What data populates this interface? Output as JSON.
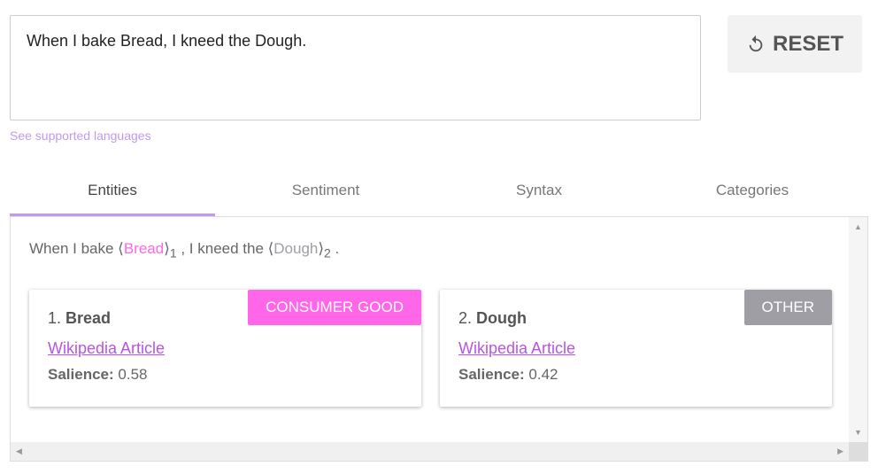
{
  "input": {
    "value": "When I bake Bread, I kneed the Dough."
  },
  "languages_link": "See supported languages",
  "reset": {
    "label": "RESET",
    "icon": "reset-icon"
  },
  "tabs": [
    {
      "label": "Entities",
      "active": true
    },
    {
      "label": "Sentiment"
    },
    {
      "label": "Syntax"
    },
    {
      "label": "Categories"
    }
  ],
  "sentence": {
    "p1": "When I bake ",
    "e1": "Bread",
    "n1": "1",
    "p2": " , I kneed the ",
    "e2": "Dough",
    "n2": "2",
    "p3": " ."
  },
  "entities": [
    {
      "index": "1.",
      "name": "Bread",
      "type": "CONSUMER GOOD",
      "color": "#ff66e8",
      "link": "Wikipedia Article",
      "salience_label": "Salience:",
      "salience": "0.58"
    },
    {
      "index": "2.",
      "name": "Dough",
      "type": "OTHER",
      "color": "#9e9ea4",
      "link": "Wikipedia Article",
      "salience_label": "Salience:",
      "salience": "0.42"
    }
  ]
}
